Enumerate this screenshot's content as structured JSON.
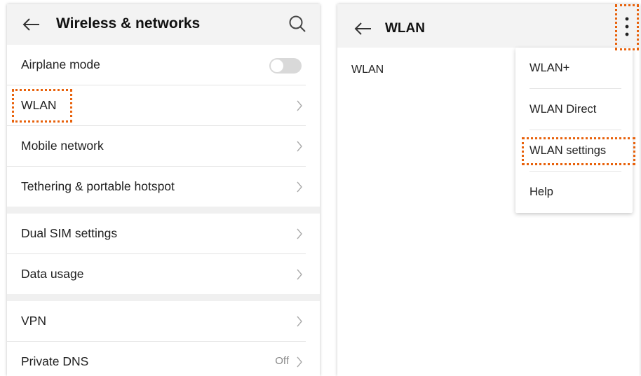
{
  "left_screen": {
    "title": "Wireless & networks",
    "icons": {
      "back": "arrow-left-icon",
      "search": "search-icon",
      "chevron": "chevron-right-icon"
    },
    "groups": [
      [
        {
          "label": "Airplane mode",
          "control": "toggle",
          "toggle_state": "off"
        },
        {
          "label": "WLAN",
          "value": "",
          "highlighted": true
        },
        {
          "label": "Mobile network"
        },
        {
          "label": "Tethering & portable hotspot"
        }
      ],
      [
        {
          "label": "Dual SIM settings"
        },
        {
          "label": "Data usage"
        }
      ],
      [
        {
          "label": "VPN"
        },
        {
          "label": "Private DNS",
          "value": "Off"
        }
      ]
    ]
  },
  "right_screen": {
    "title": "WLAN",
    "content_label": "WLAN",
    "icons": {
      "back": "arrow-left-icon",
      "more": "more-vertical-icon"
    },
    "overflow_menu": [
      "WLAN+",
      "WLAN Direct",
      "WLAN settings",
      "Help"
    ],
    "highlighted_menu_item": "WLAN settings"
  },
  "colors": {
    "highlight": "#e8620c",
    "appbar_bg": "#f3f3f3",
    "divider": "#e4e4e4",
    "section_gap": "#f0f0f0"
  }
}
